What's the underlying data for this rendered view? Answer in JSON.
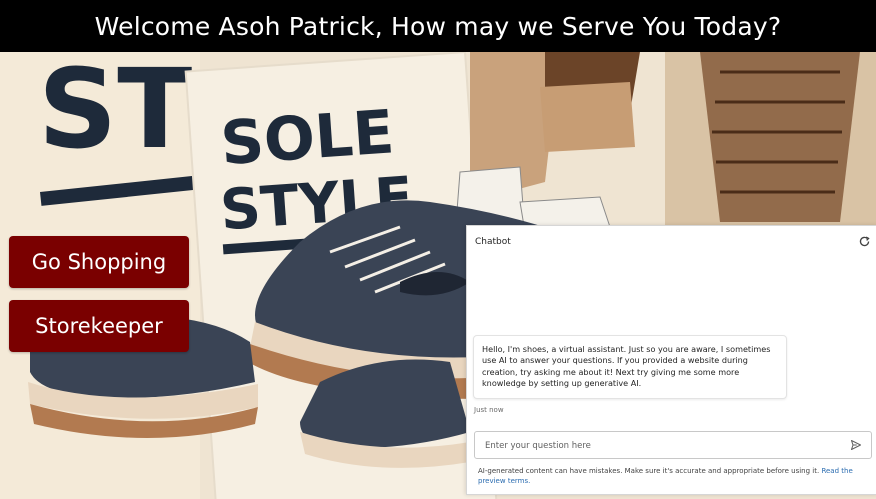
{
  "header": {
    "title": "Welcome Asoh Patrick, How may we Serve You Today?"
  },
  "hero": {
    "poster_text_line1": "SOLE",
    "poster_text_line2": "STYLE",
    "left_text": "ST"
  },
  "actions": {
    "go_shopping_label": "Go Shopping",
    "storekeeper_label": "Storekeeper"
  },
  "chatbot": {
    "title": "Chatbot",
    "message": "Hello, I'm shoes, a virtual assistant. Just so you are aware, I sometimes use AI to answer your questions. If you provided a website during creation, try asking me about it! Next try giving me some more knowledge by setting up generative AI.",
    "timestamp": "Just now",
    "input_placeholder": "Enter your question here",
    "disclaimer_text": "AI-generated content can have mistakes. Make sure it's accurate and appropriate before using it.",
    "disclaimer_link": "Read the preview terms."
  },
  "colors": {
    "header_bg": "#000000",
    "button_bg": "#7a0000",
    "link": "#2b6cb0"
  }
}
